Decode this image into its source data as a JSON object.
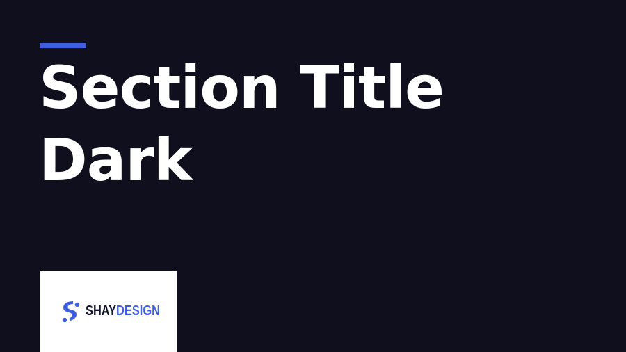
{
  "slide": {
    "title_line1": "Section Title",
    "title_line2": "Dark"
  },
  "logo": {
    "part1": "SHAY",
    "part2": "DESIGN",
    "icon": "s-logo-icon"
  },
  "colors": {
    "background": "#0f0f1e",
    "accent": "#3f5fe0",
    "title": "#ffffff",
    "logo_dark": "#141430"
  }
}
